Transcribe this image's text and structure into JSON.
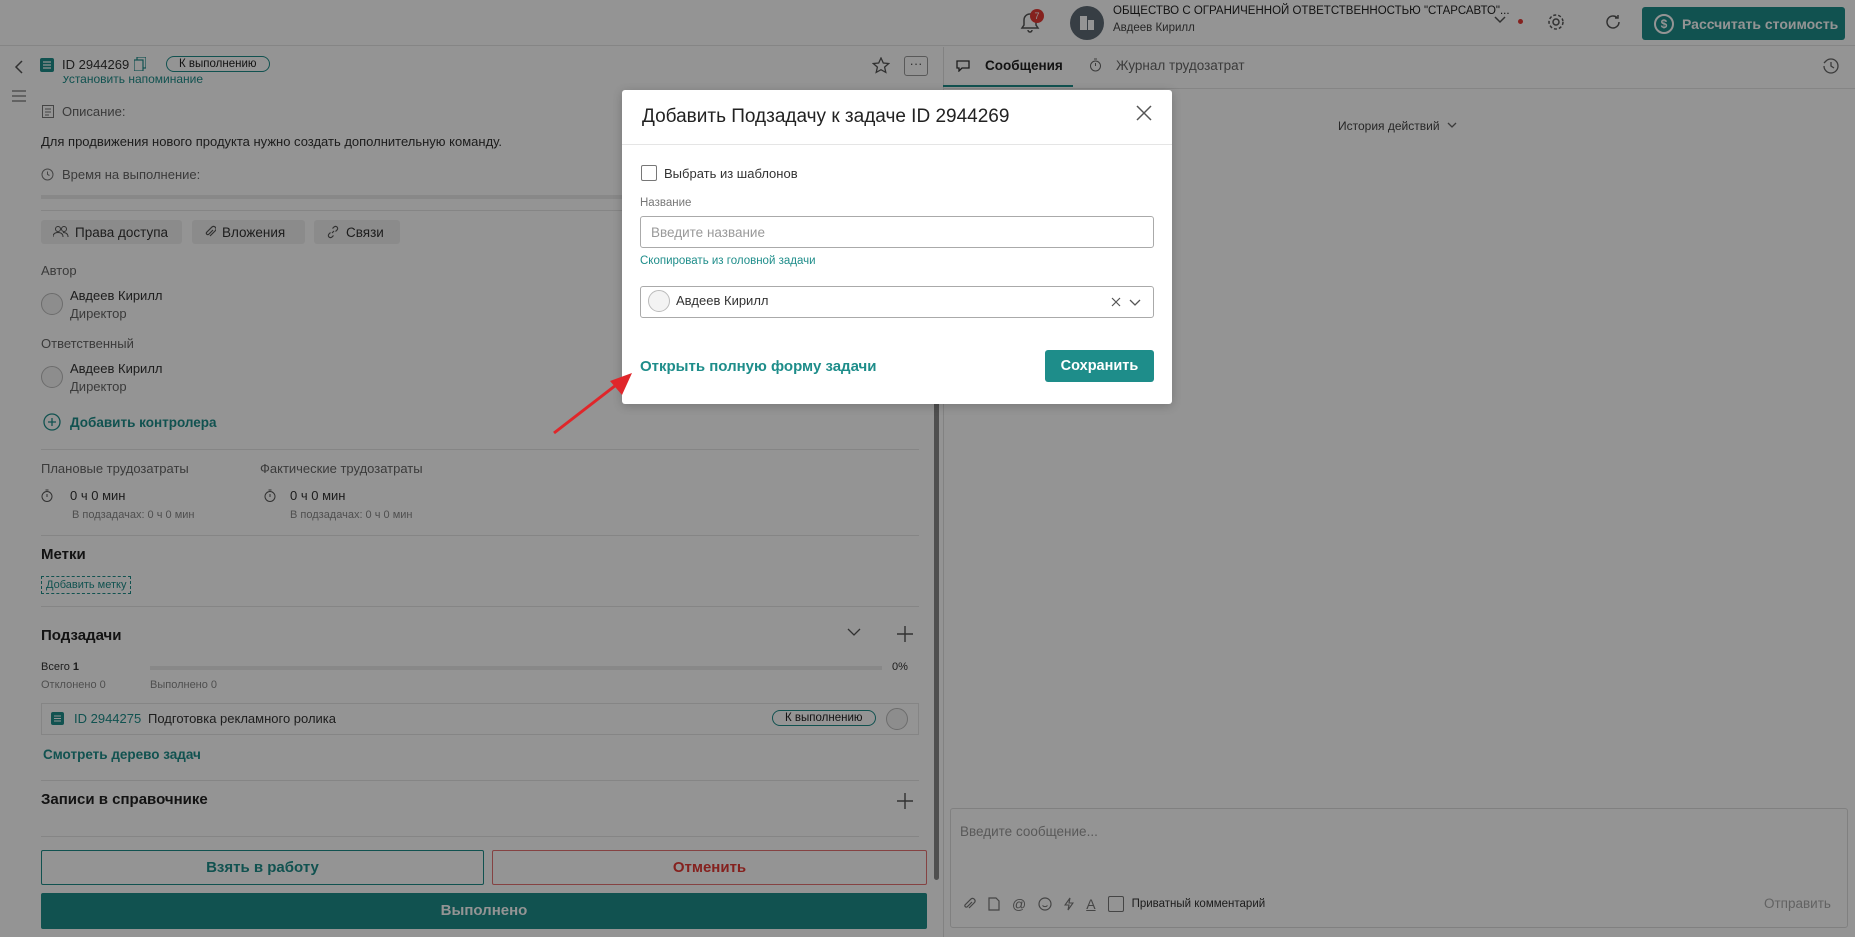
{
  "topbar": {
    "notification_count": "7",
    "org_name": "ОБЩЕСТВО С ОГРАНИЧЕННОЙ ОТВЕТСТВЕННОСТЬЮ \"СТАРСАВТО\"...",
    "user_name": "Авдеев Кирилл",
    "calc_button": "Рассчитать стоимость"
  },
  "task": {
    "id": "ID 2944269",
    "status": "К выполнению",
    "reminder_link": "Установить напоминание",
    "description_label": "Описание:",
    "description": "Для продвижения нового продукта нужно создать дополнительную команду.",
    "time_label": "Время на выполнение:",
    "tabs": [
      "Права доступа",
      "Вложения",
      "Связи"
    ],
    "author_label": "Автор",
    "author_name": "Авдеев Кирилл",
    "author_role": "Директор",
    "responsible_label": "Ответственный",
    "responsible_name": "Авдеев Кирилл",
    "responsible_role": "Директор",
    "add_controller": "Добавить контролера",
    "planned_label": "Плановые трудозатраты",
    "planned_value": "0 ч 0 мин",
    "planned_sub": "В подзадачах: 0 ч 0 мин",
    "actual_label": "Фактические трудозатраты",
    "actual_value": "0 ч 0 мин",
    "actual_sub": "В подзадачах: 0 ч 0 мин",
    "tags_title": "Метки",
    "add_tag": "Добавить метку",
    "subtasks_title": "Подзадачи",
    "total_label": "Всего",
    "total_value": "1",
    "rejected": "Отклонено 0",
    "done": "Выполнено 0",
    "progress_pct": "0%",
    "progress_fraction": 0,
    "subtask_id": "ID 2944275",
    "subtask_name": "Подготовка рекламного ролика",
    "subtask_status": "К выполнению",
    "tree_link": "Смотреть дерево задач",
    "directory_title": "Записи в справочнике",
    "take_button": "Взять в работу",
    "cancel_button": "Отменить",
    "complete_button": "Выполнено"
  },
  "right": {
    "tab_messages": "Сообщения",
    "tab_journal": "Журнал трудозатрат",
    "history": "История действий",
    "message_placeholder": "Введите сообщение...",
    "private_comment": "Приватный комментарий",
    "send": "Отправить"
  },
  "modal": {
    "title": "Добавить Подзадачу к задаче ID 2944269",
    "template_checkbox": "Выбрать из шаблонов",
    "name_label": "Название",
    "name_placeholder": "Введите название",
    "copy_link": "Скопировать из головной задачи",
    "assignee": "Авдеев Кирилл",
    "full_form_link": "Открыть полную форму задачи",
    "save_button": "Сохранить"
  }
}
